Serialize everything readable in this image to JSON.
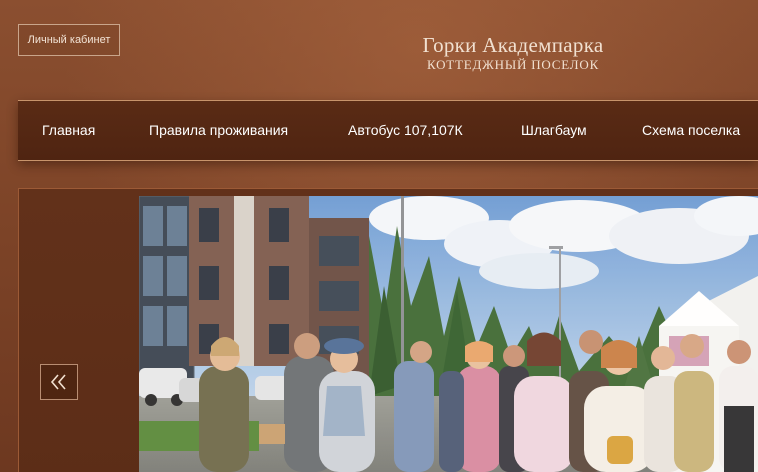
{
  "header": {
    "cabinet_label": "Личный кабинет",
    "brand_title": "Горки Академпарка",
    "brand_subtitle": "коттеджный поселок"
  },
  "nav": {
    "items": [
      {
        "label": "Главная"
      },
      {
        "label": "Правила проживания"
      },
      {
        "label": "Автобус 107,107К"
      },
      {
        "label": "Шлагбаум"
      },
      {
        "label": "Схема поселка"
      }
    ]
  },
  "slider": {
    "prev_icon": "double-chevron-left-icon",
    "image_description_icon": "photo"
  },
  "colors": {
    "background": "#7f4529",
    "nav_background": "#53270f",
    "nav_border": "#c8946b",
    "text_light": "#f1e0d0"
  }
}
